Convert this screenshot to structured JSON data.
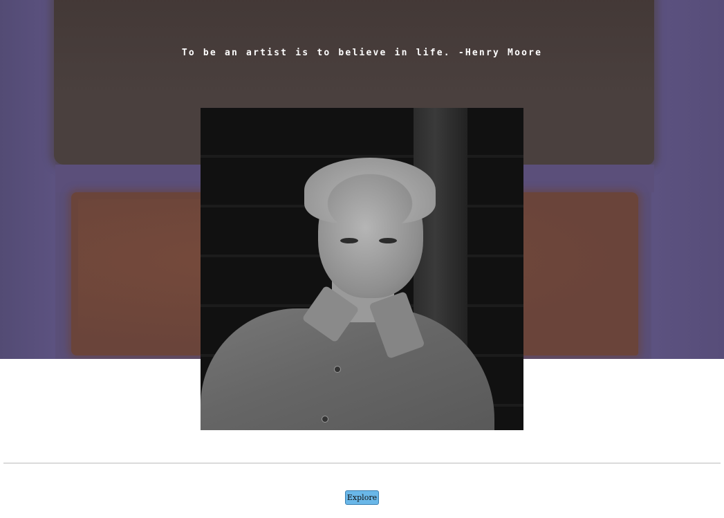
{
  "hero": {
    "background_colors": {
      "purple": "#5a4f78",
      "top_block": "#4a403e",
      "bottom_block": "#6a443a"
    },
    "quote": "To be an artist is to believe in life. -Henry Moore"
  },
  "portrait": {
    "style": "black-and-white photograph"
  },
  "actions": {
    "explore_label": "Explore",
    "explore_color": "#6ab7e8"
  }
}
